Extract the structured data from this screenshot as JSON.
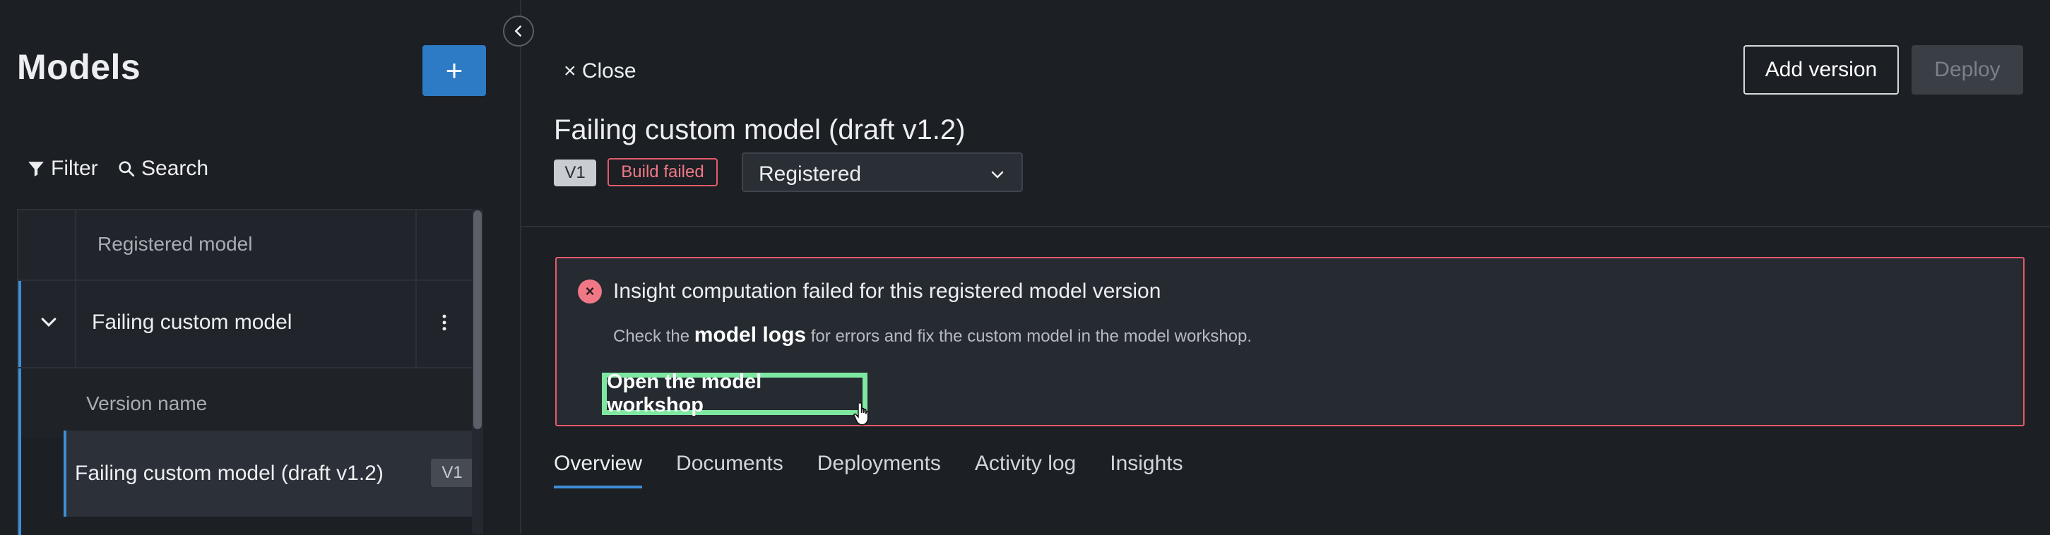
{
  "sidebar": {
    "title": "Models",
    "add_button": "+",
    "filter_label": "Filter",
    "search_label": "Search",
    "tree": {
      "header": "Registered model",
      "model_name": "Failing custom model",
      "version_header": "Version name",
      "version_name": "Failing custom model (draft v1.2)",
      "version_badge": "V1"
    }
  },
  "header": {
    "close_label": "× Close",
    "add_version_label": "Add version",
    "deploy_label": "Deploy",
    "title": "Failing custom model (draft v1.2)",
    "version_badge": "V1",
    "build_status": "Build failed",
    "status_select": "Registered"
  },
  "alert": {
    "title": "Insight computation failed for this registered model version",
    "body_prefix": "Check the",
    "body_link": "model logs",
    "body_suffix": "for errors and fix the custom model in the model workshop.",
    "action_label": "Open the model workshop"
  },
  "tabs": [
    "Overview",
    "Documents",
    "Deployments",
    "Activity log",
    "Insights"
  ],
  "active_tab": "Overview",
  "colors": {
    "background": "#1c1f24",
    "accent": "#3d8fd6",
    "primary_button": "#2d7bc4",
    "error": "#e35b6b",
    "highlight": "#7ee8a0"
  }
}
